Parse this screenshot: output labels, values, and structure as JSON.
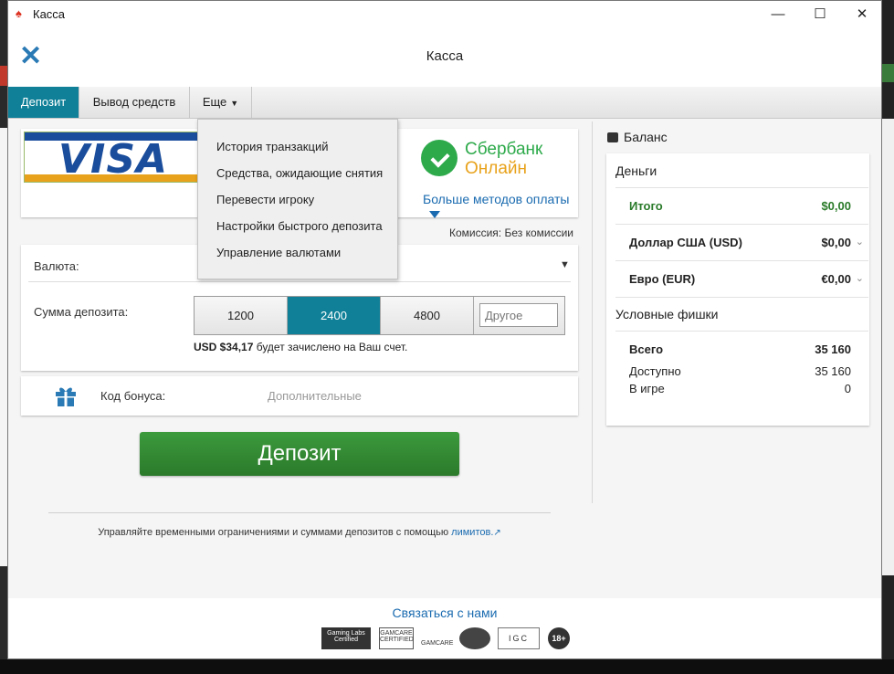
{
  "window": {
    "title": "Касса",
    "min_icon": "minimize-icon",
    "max_icon": "maximize-icon",
    "close_icon": "close-icon"
  },
  "header": {
    "title": "Касса",
    "close_icon": "close-x-icon",
    "accent_color": "#2a7ab5"
  },
  "tabs": [
    {
      "label": "Депозит",
      "active": true
    },
    {
      "label": "Вывод средств",
      "active": false
    },
    {
      "label": "Еще",
      "active": false
    }
  ],
  "more_menu": {
    "items": [
      "История транзакций",
      "Средства, ожидающие снятия",
      "Перевести игроку",
      "Настройки быстрого депозита",
      "Управление валютами"
    ]
  },
  "payment_methods": {
    "visa_label": "VISA",
    "sber_line1": "Сбербанк",
    "sber_line2": "Онлайн",
    "more_methods": "Больше методов оплаты",
    "commission": "Комиссия: Без комиссии"
  },
  "deposit": {
    "currency_label": "Валюта:",
    "amount_label": "Сумма депозита:",
    "amounts": [
      "1200",
      "2400",
      "4800"
    ],
    "selected_amount": "2400",
    "other_placeholder": "Другое",
    "credited_amount": "USD $34,17",
    "credited_suffix": " будет зачислено на Ваш счет."
  },
  "bonus": {
    "label": "Код бонуса:",
    "placeholder": "Дополнительные"
  },
  "deposit_button": "Депозит",
  "limits": {
    "text": "Управляйте временными ограничениями и суммами депозитов с помощью ",
    "link": "лимитов."
  },
  "balance": {
    "title": "Баланс",
    "money_title": "Деньги",
    "rows": [
      {
        "label": "Итого",
        "value": "$0,00"
      },
      {
        "label": "Доллар США (USD)",
        "value": "$0,00"
      },
      {
        "label": "Евро (EUR)",
        "value": "€0,00"
      }
    ],
    "chips_title": "Условные фишки",
    "chips": [
      {
        "label": "Всего",
        "value": "35 160"
      },
      {
        "label": "Доступно",
        "value": "35 160"
      },
      {
        "label": "В игре",
        "value": "0"
      }
    ]
  },
  "footer": {
    "contact": "Связаться с нами",
    "badges": [
      "Gaming Labs Certified",
      "GAMCARE CERTIFIED",
      "GAMCARE",
      "IGC",
      "18+"
    ]
  },
  "colors": {
    "teal": "#0f8098",
    "green": "#2b7a2b",
    "link": "#1a6bb0"
  }
}
